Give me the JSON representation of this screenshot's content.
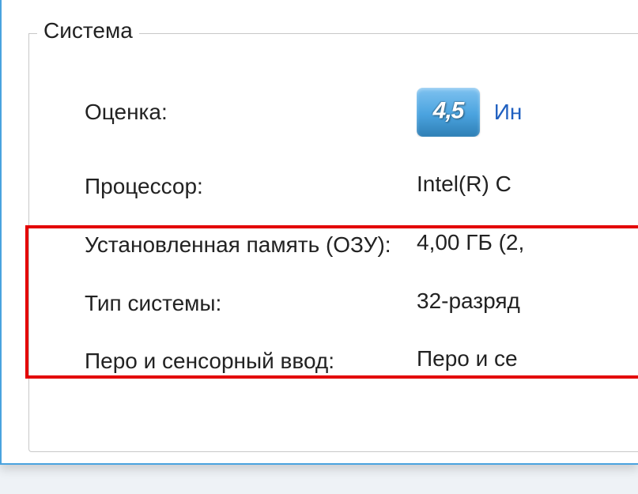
{
  "group": {
    "title": "Система"
  },
  "rating": {
    "label": "Оценка:",
    "score": "4,5",
    "link": "Ин"
  },
  "processor": {
    "label": "Процессор:",
    "value": "Intel(R) C"
  },
  "memory": {
    "label": "Установленная память (ОЗУ):",
    "value": "4,00 ГБ (2,"
  },
  "systemType": {
    "label": "Тип системы:",
    "value": "32-разряд"
  },
  "penTouch": {
    "label": "Перо и сенсорный ввод:",
    "value": "Перо и се"
  }
}
